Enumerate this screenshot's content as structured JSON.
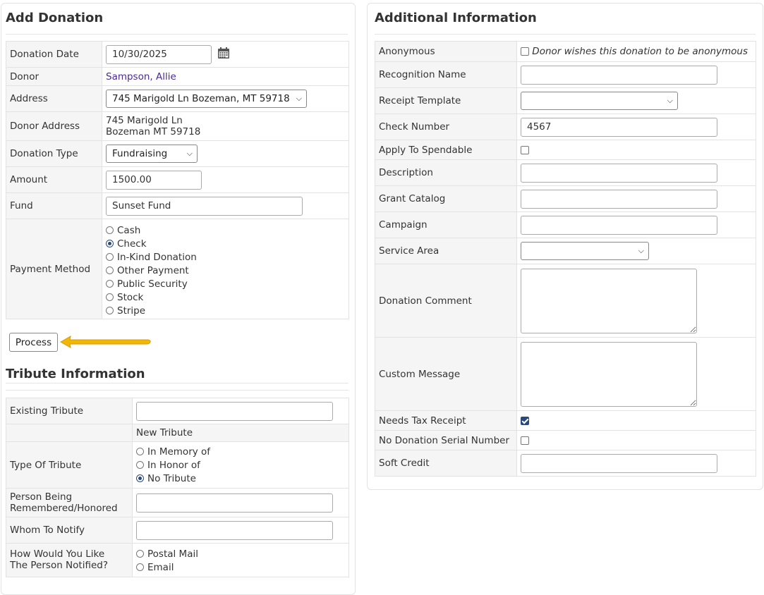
{
  "add_donation": {
    "title": "Add Donation",
    "donation_date": {
      "label": "Donation Date",
      "value": "10/30/2025"
    },
    "donor": {
      "label": "Donor",
      "value": "Sampson, Allie"
    },
    "address": {
      "label": "Address",
      "selected": "745 Marigold Ln Bozeman, MT 59718"
    },
    "donor_address": {
      "label": "Donor Address",
      "line1": "745 Marigold Ln",
      "line2": "Bozeman MT 59718"
    },
    "donation_type": {
      "label": "Donation Type",
      "selected": "Fundraising"
    },
    "amount": {
      "label": "Amount",
      "value": "1500.00"
    },
    "fund": {
      "label": "Fund",
      "value": "Sunset Fund"
    },
    "payment_method": {
      "label": "Payment Method",
      "options": [
        "Cash",
        "Check",
        "In-Kind Donation",
        "Other Payment",
        "Public Security",
        "Stock",
        "Stripe"
      ],
      "selected": "Check"
    },
    "process_label": "Process"
  },
  "tribute": {
    "title": "Tribute Information",
    "existing_tribute": {
      "label": "Existing Tribute",
      "value": ""
    },
    "new_tribute_label": "New Tribute",
    "type_of_tribute": {
      "label": "Type Of Tribute",
      "options": [
        "In Memory of",
        "In Honor of",
        "No Tribute"
      ],
      "selected": "No Tribute"
    },
    "person_remembered": {
      "label_line1": "Person Being",
      "label_line2": "Remembered/Honored",
      "value": ""
    },
    "whom_to_notify": {
      "label": "Whom To Notify",
      "value": ""
    },
    "notify_method": {
      "label_line1": "How Would You Like",
      "label_line2": "The Person Notified?",
      "options": [
        "Postal Mail",
        "Email"
      ]
    }
  },
  "additional": {
    "title": "Additional Information",
    "anonymous": {
      "label": "Anonymous",
      "checkbox_label": "Donor wishes this donation to be anonymous",
      "checked": false
    },
    "recognition_name": {
      "label": "Recognition Name",
      "value": ""
    },
    "receipt_template": {
      "label": "Receipt Template",
      "selected": ""
    },
    "check_number": {
      "label": "Check Number",
      "value": "4567"
    },
    "apply_to_spendable": {
      "label": "Apply To Spendable",
      "checked": false
    },
    "description": {
      "label": "Description",
      "value": ""
    },
    "grant_catalog": {
      "label": "Grant Catalog",
      "value": ""
    },
    "campaign": {
      "label": "Campaign",
      "value": ""
    },
    "service_area": {
      "label": "Service Area",
      "selected": ""
    },
    "donation_comment": {
      "label": "Donation Comment",
      "value": ""
    },
    "custom_message": {
      "label": "Custom Message",
      "value": ""
    },
    "needs_tax_receipt": {
      "label": "Needs Tax Receipt",
      "checked": true
    },
    "no_serial_number": {
      "label": "No Donation Serial Number",
      "checked": false
    },
    "soft_credit": {
      "label": "Soft Credit",
      "value": ""
    }
  },
  "colors": {
    "label_bg": "#f5f5f5",
    "border": "#e2e2e2",
    "link": "#4b2a9a",
    "arrow": "#f2b705",
    "checkbox_checked": "#2b4a7c"
  },
  "icons": {
    "calendar": "calendar-icon",
    "arrow": "arrow-left-icon"
  }
}
